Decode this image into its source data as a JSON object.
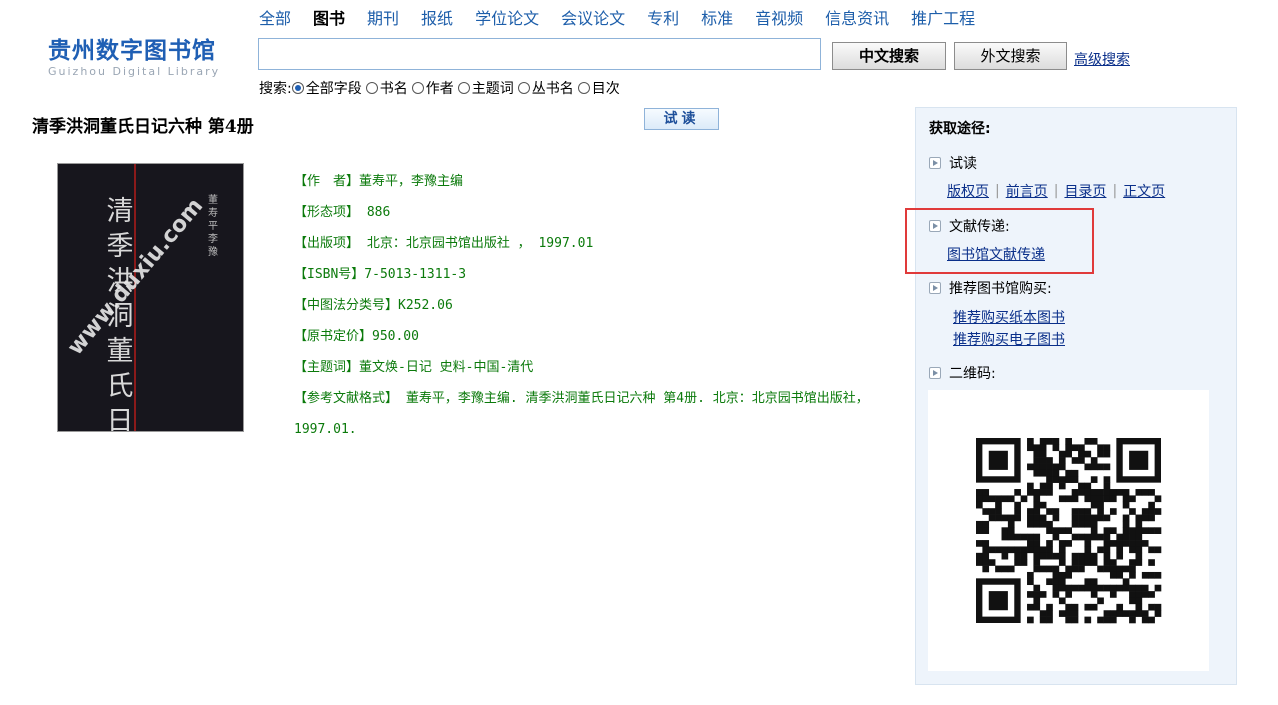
{
  "logo": {
    "cn": "贵州数字图书馆",
    "en": "Guizhou Digital Library"
  },
  "nav": [
    {
      "label": "全部",
      "active": false
    },
    {
      "label": "图书",
      "active": true
    },
    {
      "label": "期刊",
      "active": false
    },
    {
      "label": "报纸",
      "active": false
    },
    {
      "label": "学位论文",
      "active": false
    },
    {
      "label": "会议论文",
      "active": false
    },
    {
      "label": "专利",
      "active": false
    },
    {
      "label": "标准",
      "active": false
    },
    {
      "label": "音视频",
      "active": false
    },
    {
      "label": "信息资讯",
      "active": false
    },
    {
      "label": "推广工程",
      "active": false
    }
  ],
  "search": {
    "value": "",
    "btn_cn": "中文搜索",
    "btn_foreign": "外文搜索",
    "advanced": "高级搜索",
    "scope_label": "搜索:",
    "scopes": [
      "全部字段",
      "书名",
      "作者",
      "主题词",
      "丛书名",
      "目次"
    ],
    "selected_scope": "全部字段"
  },
  "book": {
    "title": "清季洪洞董氏日记六种  第4册",
    "try_read": "试读",
    "cover": {
      "title_vertical": "清季洪洞董氏日记",
      "watermark": "www.duxiu.com"
    },
    "meta": [
      "【作　者】董寿平，李豫主编",
      "【形态项】 886",
      "【出版项】 北京：北京园书馆出版社 ， 1997.01",
      "【ISBN号】7-5013-1311-3",
      "【中图法分类号】K252.06",
      "【原书定价】950.00",
      "【主题词】董文焕-日记 史料-中国-清代"
    ],
    "citation": "【参考文献格式】 董寿平，李豫主编. 清季洪洞董氏日记六种 第4册. 北京：北京园书馆出版社，1997.01."
  },
  "panel": {
    "heading": "获取途径:",
    "trial": {
      "label": "试读",
      "links": [
        "版权页",
        "前言页",
        "目录页",
        "正文页"
      ]
    },
    "delivery": {
      "label": "文献传递:",
      "link": "图书馆文献传递"
    },
    "purchase": {
      "label": "推荐图书馆购买:",
      "links": [
        "推荐购买纸本图书",
        "推荐购买电子图书"
      ]
    },
    "qr": {
      "label": "二维码:"
    }
  },
  "colors": {
    "link_blue": "#0a2f8a",
    "nav_blue": "#1d5eaa",
    "meta_green": "#0b7a0b",
    "highlight_red": "#e03a3a"
  }
}
